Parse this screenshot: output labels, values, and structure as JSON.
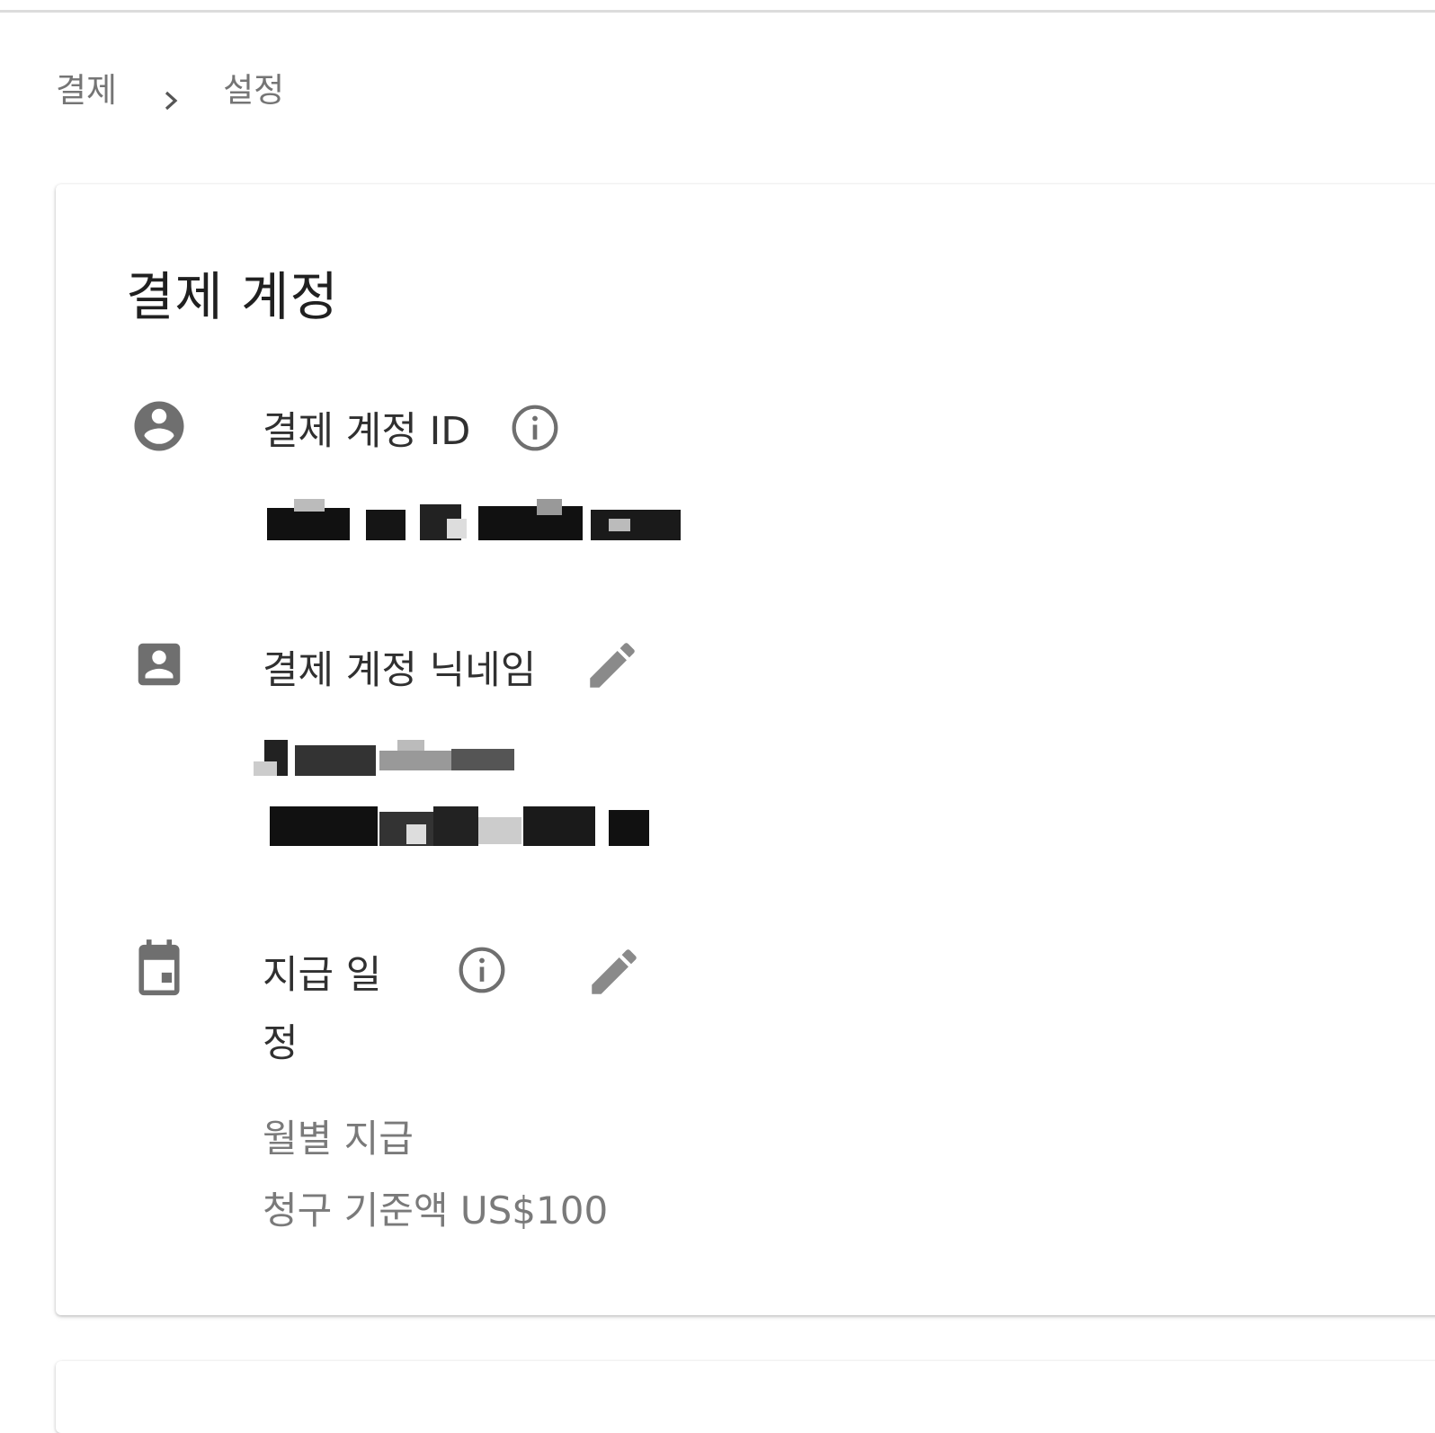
{
  "breadcrumb": {
    "items": [
      "결제",
      "설정"
    ]
  },
  "billing_account": {
    "title": "결제 계정",
    "id_row": {
      "label": "결제 계정 ID",
      "icon": "account-circle-icon",
      "info_icon": "info-icon"
    },
    "nickname_row": {
      "label": "결제 계정 닉네임",
      "icon": "account-box-icon",
      "edit_icon": "pencil-icon"
    },
    "schedule_row": {
      "label_line1": "지급 일",
      "label_line2": "정",
      "icon": "calendar-icon",
      "info_icon": "info-icon",
      "edit_icon": "pencil-icon",
      "frequency": "월별 지급",
      "threshold": "청구 기준액 US$100"
    }
  },
  "colors": {
    "icon": "#6f6f6f",
    "label": "#303030",
    "secondary": "#7a7a7a",
    "pencil": "#8a8a8a"
  }
}
